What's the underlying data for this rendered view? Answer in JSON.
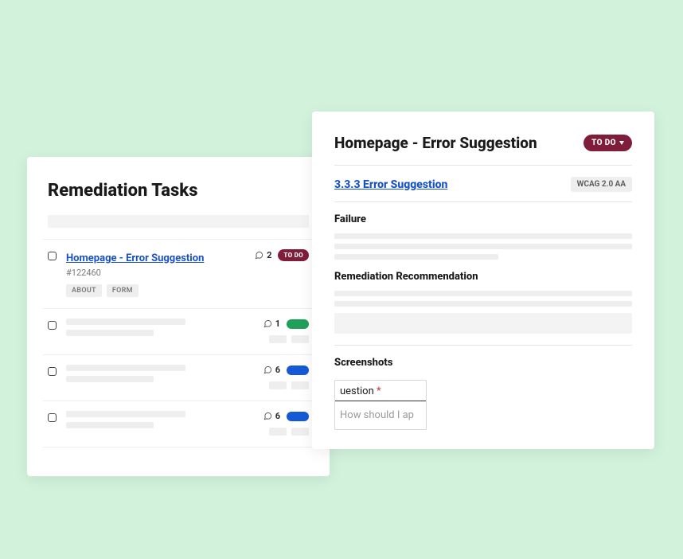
{
  "left_panel": {
    "title": "Remediation Tasks",
    "tasks": [
      {
        "title": "Homepage - Error Suggestion",
        "id": "#122460",
        "comments": "2",
        "status": "TO DO",
        "tags": [
          "ABOUT",
          "FORM"
        ]
      },
      {
        "comments": "1",
        "pill": "green"
      },
      {
        "comments": "6",
        "pill": "blue"
      },
      {
        "comments": "6",
        "pill": "blue"
      }
    ]
  },
  "right_panel": {
    "title": "Homepage - Error Suggestion",
    "status": "TO DO",
    "criterion": "3.3.3 Error Suggestion",
    "wcag_level": "WCAG 2.0 AA",
    "sections": {
      "failure": "Failure",
      "remediation": "Remediation Recommendation",
      "screenshots": "Screenshots"
    },
    "screenshot_crop": {
      "label_fragment": "uestion",
      "required_mark": "*",
      "input_fragment": "How should I ap"
    }
  }
}
